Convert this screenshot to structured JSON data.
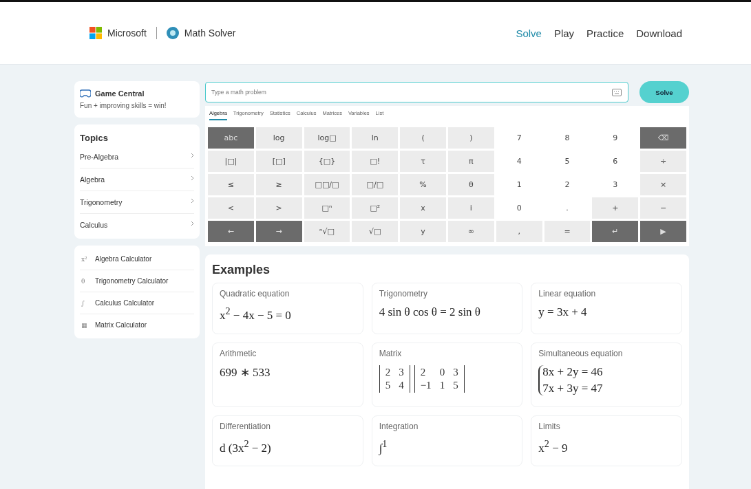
{
  "header": {
    "company": "Microsoft",
    "product": "Math Solver",
    "nav": [
      {
        "label": "Solve",
        "selected": true
      },
      {
        "label": "Play",
        "selected": false
      },
      {
        "label": "Practice",
        "selected": false
      },
      {
        "label": "Download",
        "selected": false
      }
    ]
  },
  "game_central": {
    "title": "Game Central",
    "subtitle": "Fun + improving skills = win!"
  },
  "topics": {
    "title": "Topics",
    "items": [
      "Pre-Algebra",
      "Algebra",
      "Trigonometry",
      "Calculus"
    ]
  },
  "calculators": [
    {
      "glyph": "x²",
      "label": "Algebra Calculator"
    },
    {
      "glyph": "θ",
      "label": "Trigonometry Calculator"
    },
    {
      "glyph": "∫",
      "label": "Calculus Calculator"
    },
    {
      "glyph": "▦",
      "label": "Matrix Calculator"
    }
  ],
  "search": {
    "placeholder": "Type a math problem",
    "button": "Solve"
  },
  "keyboard_tabs": [
    {
      "label": "Algebra",
      "selected": true
    },
    {
      "label": "Trigonometry",
      "selected": false
    },
    {
      "label": "Statistics",
      "selected": false
    },
    {
      "label": "Calculus",
      "selected": false
    },
    {
      "label": "Matrices",
      "selected": false
    },
    {
      "label": "Variables",
      "selected": false
    },
    {
      "label": "List",
      "selected": false
    }
  ],
  "keys": [
    {
      "label": "abc",
      "kind": "dark"
    },
    {
      "label": "log",
      "kind": "light"
    },
    {
      "label": "log□",
      "kind": "light"
    },
    {
      "label": "ln",
      "kind": "light"
    },
    {
      "label": "(",
      "kind": "light"
    },
    {
      "label": ")",
      "kind": "light"
    },
    {
      "label": "7",
      "kind": "plain"
    },
    {
      "label": "8",
      "kind": "plain"
    },
    {
      "label": "9",
      "kind": "plain"
    },
    {
      "label": "⌫",
      "kind": "dark"
    },
    {
      "label": "|□|",
      "kind": "light"
    },
    {
      "label": "[□]",
      "kind": "light"
    },
    {
      "label": "{□}",
      "kind": "light"
    },
    {
      "label": "□!",
      "kind": "light"
    },
    {
      "label": "τ",
      "kind": "light"
    },
    {
      "label": "π",
      "kind": "light"
    },
    {
      "label": "4",
      "kind": "plain"
    },
    {
      "label": "5",
      "kind": "plain"
    },
    {
      "label": "6",
      "kind": "plain"
    },
    {
      "label": "÷",
      "kind": "light"
    },
    {
      "label": "≤",
      "kind": "light"
    },
    {
      "label": "≥",
      "kind": "light"
    },
    {
      "label": "□□/□",
      "kind": "light"
    },
    {
      "label": "□/□",
      "kind": "light"
    },
    {
      "label": "%",
      "kind": "light"
    },
    {
      "label": "θ",
      "kind": "light"
    },
    {
      "label": "1",
      "kind": "plain"
    },
    {
      "label": "2",
      "kind": "plain"
    },
    {
      "label": "3",
      "kind": "plain"
    },
    {
      "label": "×",
      "kind": "light"
    },
    {
      "label": "<",
      "kind": "light"
    },
    {
      "label": ">",
      "kind": "light"
    },
    {
      "label": "□ⁿ",
      "kind": "light"
    },
    {
      "label": "□²",
      "kind": "light"
    },
    {
      "label": "x",
      "kind": "light"
    },
    {
      "label": "i",
      "kind": "light"
    },
    {
      "label": "0",
      "kind": "plain"
    },
    {
      "label": ".",
      "kind": "plain"
    },
    {
      "label": "+",
      "kind": "light"
    },
    {
      "label": "−",
      "kind": "light"
    },
    {
      "label": "←",
      "kind": "dark"
    },
    {
      "label": "→",
      "kind": "dark"
    },
    {
      "label": "ⁿ√□",
      "kind": "light"
    },
    {
      "label": "√□",
      "kind": "light"
    },
    {
      "label": "y",
      "kind": "light"
    },
    {
      "label": "∞",
      "kind": "light"
    },
    {
      "label": ",",
      "kind": "light"
    },
    {
      "label": "=",
      "kind": "light"
    },
    {
      "label": "↵",
      "kind": "dark"
    },
    {
      "label": "▶",
      "kind": "dark"
    }
  ],
  "examples": {
    "title": "Examples",
    "cards": [
      {
        "title": "Quadratic equation",
        "kind": "inline",
        "formula": "x$^{2}$ − 4x − 5 = 0"
      },
      {
        "title": "Trigonometry",
        "kind": "inline",
        "formula": "4 sin θ cos θ = 2 sin θ"
      },
      {
        "title": "Linear equation",
        "kind": "inline",
        "formula": "y = 3x + 4"
      },
      {
        "title": "Arithmetic",
        "kind": "inline",
        "formula": "699 ∗ 533"
      },
      {
        "title": "Matrix",
        "kind": "matrix",
        "matrices": [
          [
            [
              "2",
              "3"
            ],
            [
              "5",
              "4"
            ]
          ],
          [
            [
              "2",
              "0",
              "3"
            ],
            [
              "−1",
              "1",
              "5"
            ]
          ]
        ]
      },
      {
        "title": "Simultaneous equation",
        "kind": "system",
        "lines": [
          "8x + 2y = 46",
          "7x + 3y = 47"
        ]
      },
      {
        "title": "Differentiation",
        "kind": "inline",
        "formula": "d  (3x$^{2}$ − 2)"
      },
      {
        "title": "Integration",
        "kind": "inline",
        "formula": "∫$^{1}$"
      },
      {
        "title": "Limits",
        "kind": "inline",
        "formula": "x$^{2}$ − 9"
      }
    ]
  }
}
